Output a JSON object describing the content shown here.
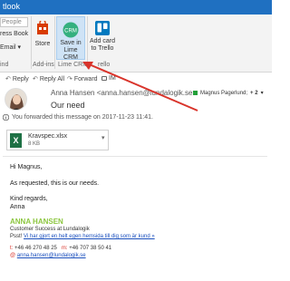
{
  "titlebar": {
    "title": "tlook"
  },
  "ribbon": {
    "people_field": "People",
    "address_book": "ress Book",
    "email_line": "Email",
    "find_group": "ind",
    "store_label": "Store",
    "addins_group": "Add-ins",
    "save_lime_label_1": "Save in",
    "save_lime_label_2": "Lime CRM",
    "save_lime_icon_text": "CRM",
    "lime_group": "Lime CRM",
    "trello_label_1": "Add card",
    "trello_label_2": "to Trello",
    "trello_group": "rello"
  },
  "toolbar": {
    "reply": "Reply",
    "reply_all": "Reply All",
    "forward": "Forward",
    "im": "IM"
  },
  "message": {
    "sender": "Anna Hansen <anna.hansen@lundalogik.se>",
    "subject": "Our need",
    "recipient": "Magnus Pagerlund;",
    "recipient_more": "+ 2",
    "info": "You forwarded this message on 2017-11-23 11:41."
  },
  "attachment": {
    "name": "Kravspec.xlsx",
    "size": "8 KB",
    "icon_letter": "X"
  },
  "body": {
    "greeting": "Hi Magnus,",
    "line1": "As requested, this is our needs.",
    "closing": "Kind regards,",
    "name": "Anna"
  },
  "signature": {
    "name": "ANNA HANSEN",
    "title": "Customer Success at Lundalogik",
    "pssst": "Psst!",
    "promo": "Vi har gjort en helt egen hemsida till dig som är kund »",
    "t_label": "t:",
    "phone1": "+46 46 270 48 25",
    "m_label": "m:",
    "phone2": "+46 707 38 50 41",
    "e_label": "@",
    "email": "anna.hansen@lundalogik.se"
  },
  "colors": {
    "titlebar": "#1f70c1",
    "ribbon": "#f3f3f3",
    "signature_name": "#8cc63f",
    "link": "#1a4fbd",
    "arrow": "#d9342b"
  }
}
